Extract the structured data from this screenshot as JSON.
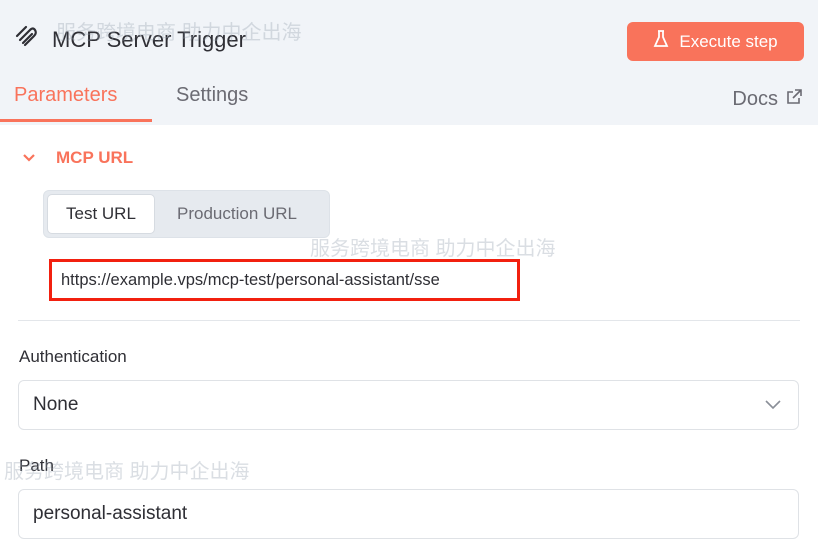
{
  "header": {
    "title": "MCP Server Trigger",
    "execute_label": "Execute step"
  },
  "tabs": [
    {
      "label": "Parameters"
    },
    {
      "label": "Settings"
    }
  ],
  "docs_label": "Docs",
  "mcp_url": {
    "section_label": "MCP URL",
    "toggle": [
      "Test URL",
      "Production URL"
    ],
    "selected": "Test URL",
    "url": "https://example.vps/mcp-test/personal-assistant/sse"
  },
  "authentication": {
    "label": "Authentication",
    "value": "None"
  },
  "path": {
    "label": "Path",
    "value": "personal-assistant"
  },
  "watermark": "主机侦探 服务跨境电商 助力中企出海",
  "colors": {
    "accent": "#f9735b",
    "highlight": "#f2200f"
  }
}
